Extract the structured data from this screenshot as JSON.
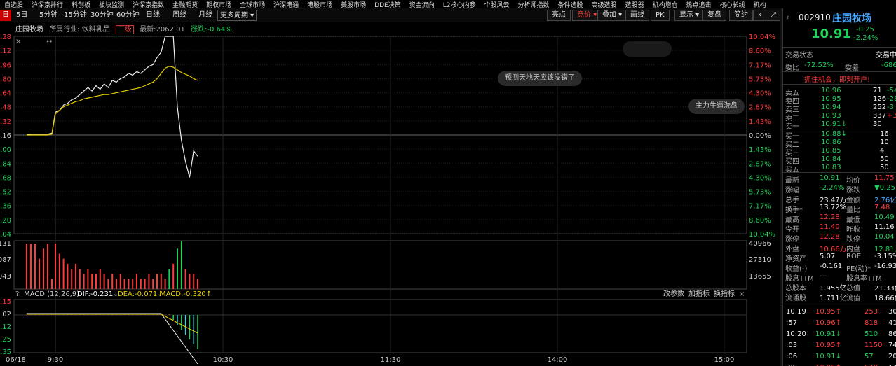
{
  "menu": [
    "自选股",
    "沪深京排行",
    "科创板",
    "板块监测",
    "沪深京指数",
    "金融期货",
    "期权市场",
    "全球市场",
    "沪深港通",
    "港股市场",
    "美股市场",
    "DDE决策",
    "资金流向",
    "L2核心内参",
    "个股风云",
    "分析师指数",
    "条件选股",
    "高级选股",
    "选股器",
    "机构增仓",
    "热点追击",
    "核心长线",
    "机构"
  ],
  "periods": [
    "日",
    "5日",
    "5分钟",
    "15分钟",
    "30分钟",
    "60分钟",
    "日线",
    "周线",
    "月线",
    "更多周期"
  ],
  "tools": [
    "亮点",
    "竞价",
    "叠加",
    "画线",
    "PK",
    "显示",
    "复盘",
    "简约"
  ],
  "info": {
    "name": "庄园牧场",
    "industry_label": "所属行业: 饮料乳品",
    "tier": "二级",
    "latest": "最新:2062.01",
    "change": "涨跌:-0.64%"
  },
  "chart_data": {
    "type": "line",
    "y_left_ticks": [
      "2.28",
      "2.12",
      "1.96",
      "1.80",
      "1.64",
      "1.48",
      "1.32",
      "1.16",
      "1.00",
      "0.84",
      "0.68",
      "0.52",
      "0.36",
      "0.20",
      "0.04"
    ],
    "y_right_ticks": [
      "10.04%",
      "8.60%",
      "7.17%",
      "5.73%",
      "4.30%",
      "2.87%",
      "1.43%",
      "0.00%",
      "1.43%",
      "2.87%",
      "4.30%",
      "5.73%",
      "7.17%",
      "8.60%",
      "10.04%"
    ],
    "x_ticks": [
      "06/18",
      "9:30",
      "10:30",
      "11:30",
      "14:00",
      "15:00"
    ],
    "price_series": [
      1.16,
      1.17,
      1.17,
      1.17,
      1.17,
      1.17,
      1.18,
      1.42,
      1.44,
      1.5,
      1.52,
      1.56,
      1.58,
      1.62,
      1.66,
      1.7,
      1.66,
      1.72,
      1.68,
      1.74,
      1.7,
      1.78,
      1.76,
      1.8,
      1.82,
      1.86,
      1.84,
      1.88,
      1.86,
      1.9,
      1.94,
      1.96,
      2.04,
      2.1,
      2.28,
      2.28,
      2.28,
      1.48,
      1.1,
      0.86,
      0.68,
      0.98,
      0.92
    ],
    "avg_series": [
      1.16,
      1.16,
      1.16,
      1.16,
      1.16,
      1.16,
      1.17,
      1.4,
      1.44,
      1.48,
      1.5,
      1.52,
      1.54,
      1.55,
      1.57,
      1.58,
      1.59,
      1.6,
      1.61,
      1.62,
      1.62,
      1.63,
      1.64,
      1.65,
      1.66,
      1.67,
      1.68,
      1.69,
      1.7,
      1.72,
      1.74,
      1.76,
      1.8,
      1.86,
      1.92,
      1.94,
      1.93,
      1.9,
      1.87,
      1.85,
      1.83,
      1.8,
      1.78
    ],
    "vol_ticks": [
      "131",
      "40966",
      "087",
      "27310",
      "043",
      "13655"
    ],
    "volumes": [
      9,
      9,
      9,
      6,
      8,
      9,
      2,
      9,
      7,
      6,
      5,
      4,
      5,
      4,
      3,
      4,
      3,
      3,
      4,
      3,
      2,
      3,
      2,
      3,
      2,
      2,
      2,
      3,
      2,
      2,
      3,
      2,
      3,
      3,
      2,
      4,
      5,
      8,
      9,
      4,
      3,
      3,
      2
    ],
    "macd_label": "MACD (12,26,9)",
    "dif": "DIF:-0.231",
    "dea": "DEA:-0.071",
    "macd": "MACD:-0.320",
    "macd_ticks": [
      "0.15",
      "0.02",
      "0.12",
      "0.25",
      "0.35"
    ],
    "macd_links": [
      "改参数",
      "加指标",
      "换指标"
    ]
  },
  "bubbles": [
    "预测天地天应该没错了",
    "主力牛逼洗盘"
  ],
  "panel": {
    "code": "002910",
    "name": "庄园牧场",
    "price": "10.91",
    "chg": "-0.25",
    "pct": "-2.24%",
    "status_label": "交易状态",
    "status_right": "交易中",
    "webi_label": "委比",
    "webi": "-72.52%",
    "weicha_label": "委差",
    "weicha": "-686",
    "promo": "抓住机会，即刻开户!",
    "asks": [
      {
        "label": "卖五",
        "price": "10.96",
        "vol": "71",
        "chg": "-54"
      },
      {
        "label": "卖四",
        "price": "10.95",
        "vol": "126",
        "chg": "-28"
      },
      {
        "label": "卖三",
        "price": "10.94",
        "vol": "252",
        "chg": "-3"
      },
      {
        "label": "卖二",
        "price": "10.93",
        "vol": "337",
        "chg": "+337"
      },
      {
        "label": "卖一",
        "price": "10.91↓",
        "vol": "30",
        "chg": ""
      }
    ],
    "bids": [
      {
        "label": "买一",
        "price": "10.88↓",
        "vol": "16",
        "chg": ""
      },
      {
        "label": "买二",
        "price": "10.86",
        "vol": "10",
        "chg": ""
      },
      {
        "label": "买三",
        "price": "10.85",
        "vol": "4",
        "chg": ""
      },
      {
        "label": "买四",
        "price": "10.84",
        "vol": "50",
        "chg": ""
      },
      {
        "label": "买五",
        "price": "10.83",
        "vol": "50",
        "chg": ""
      }
    ],
    "stats": [
      {
        "l": "最新",
        "v": "10.91",
        "v_cls": "green",
        "l2": "均价",
        "v2": "11.75",
        "v2_cls": "red"
      },
      {
        "l": "涨幅",
        "v": "-2.24%",
        "v_cls": "green",
        "l2": "涨跌",
        "v2": "▼0.25",
        "v2_cls": "green"
      },
      {
        "l": "总手",
        "v": "23.47万",
        "v_cls": "white",
        "l2": "金额",
        "v2": "2.76亿",
        "v2_cls": "blue"
      },
      {
        "l": "换手*",
        "v": "13.72%",
        "v_cls": "white",
        "l2": "量比",
        "v2": "7.48",
        "v2_cls": "red"
      },
      {
        "l": "最高",
        "v": "12.28",
        "v_cls": "red",
        "l2": "最低",
        "v2": "10.49",
        "v2_cls": "green"
      },
      {
        "l": "今开",
        "v": "11.40",
        "v_cls": "red",
        "l2": "昨收",
        "v2": "11.16",
        "v2_cls": "white"
      },
      {
        "l": "涨停",
        "v": "12.28",
        "v_cls": "red",
        "l2": "跌停",
        "v2": "10.04",
        "v2_cls": "green"
      },
      {
        "l": "外盘",
        "v": "10.66万",
        "v_cls": "red",
        "l2": "内盘",
        "v2": "12.81万",
        "v2_cls": "green"
      },
      {
        "l": "净资产",
        "v": "5.07",
        "v_cls": "white",
        "l2": "ROE",
        "v2": "-3.15%",
        "v2_cls": "white"
      },
      {
        "l": "收益(-)",
        "v": "-0.161",
        "v_cls": "white",
        "l2": "PE(动)*",
        "v2": "-16.93",
        "v2_cls": "white"
      },
      {
        "l": "股息TTM",
        "v": "—",
        "v_cls": "white",
        "l2": "股息率TTM",
        "v2": "—",
        "v2_cls": "white"
      },
      {
        "l": "总股本",
        "v": "1.955亿",
        "v_cls": "white",
        "l2": "总值",
        "v2": "21.33亿",
        "v2_cls": "white"
      },
      {
        "l": "流通股",
        "v": "1.711亿",
        "v_cls": "white",
        "l2": "流值",
        "v2": "18.66亿",
        "v2_cls": "white"
      }
    ],
    "ticks": [
      {
        "t": "10:19",
        "p": "10.95↑",
        "v": "253",
        "n": "30",
        "c": "red"
      },
      {
        "t": ":57",
        "p": "10.96↑",
        "v": "818",
        "n": "41",
        "c": "red"
      },
      {
        "t": "10:20",
        "p": "10.91↓",
        "v": "510",
        "n": "86",
        "c": "green"
      },
      {
        "t": ":03",
        "p": "10.95↑",
        "v": "1150",
        "n": "74",
        "c": "red"
      },
      {
        "t": ":06",
        "p": "10.91↓",
        "v": "57",
        "n": "20",
        "c": "green"
      },
      {
        "t": ":09",
        "p": "10.95↑",
        "v": "540",
        "n": "14",
        "c": "red"
      }
    ]
  }
}
